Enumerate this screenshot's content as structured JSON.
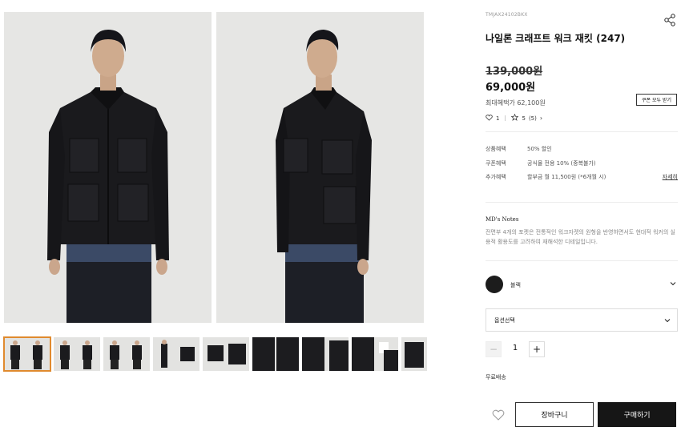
{
  "product": {
    "code": "TMJAX24102BKX",
    "title": "나일론 크래프트 워크 재킷 (247)",
    "original_price": "139,000원",
    "price": "69,000원",
    "max_benefit": "최대혜택가 62,100원",
    "coupon_button": "쿠폰 모두 받기",
    "likes": "1",
    "rating": "5",
    "review_count": "(5)"
  },
  "benefits": [
    {
      "key": "상품혜택",
      "value": "50% 할인"
    },
    {
      "key": "쿠폰혜택",
      "value": "공식몰 전용 10% (중복불가)"
    },
    {
      "key": "추가혜택",
      "value": "할부금 월 11,500원 (*6개월 시)",
      "link": "자세히"
    }
  ],
  "md_notes": {
    "title": "MD's Notes",
    "text": "전면부 4개의 포켓은 전통적인 워크자켓의 원형을 반영하면서도 현대적 워커의 실용적 활용도를 고려하여 재해석한 디테일입니다."
  },
  "color": {
    "name": "블랙",
    "swatch": "#1c1c1c"
  },
  "option_select": {
    "label": "옵션선택"
  },
  "quantity": {
    "value": "1",
    "minus": "−",
    "plus": "+"
  },
  "shipping": "무료배송",
  "actions": {
    "cart": "장바구니",
    "buy": "구매하기"
  },
  "gallery": {
    "thumb_count": 14,
    "selected_index": 0
  },
  "icons": {
    "share": "share-icon",
    "wish": "heart-icon",
    "chevron": "chevron-down-icon"
  }
}
